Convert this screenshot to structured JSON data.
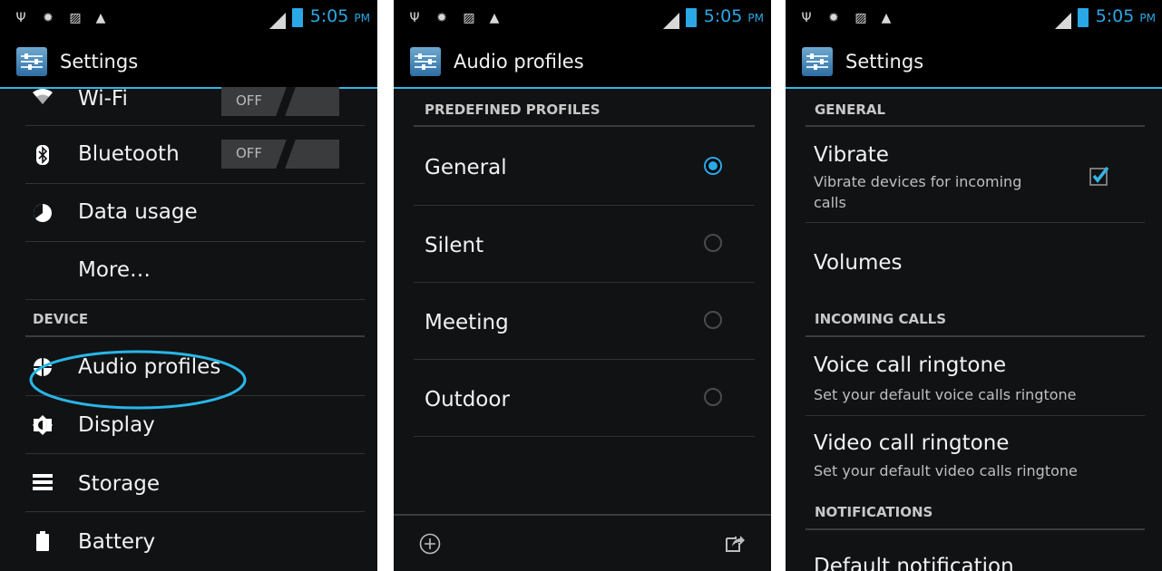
{
  "status_bar": {
    "time": "5:05",
    "ampm": "PM",
    "icons": [
      "usb-icon",
      "android-debug-icon",
      "image-notification-icon",
      "warning-icon",
      "signal-icon",
      "battery-charging-icon"
    ]
  },
  "screens": [
    {
      "title": "Settings",
      "items": [
        {
          "label": "Wi-Fi",
          "icon": "wifi-icon",
          "toggle": "OFF"
        },
        {
          "label": "Bluetooth",
          "icon": "bluetooth-icon",
          "toggle": "OFF"
        },
        {
          "label": "Data usage",
          "icon": "data-usage-icon"
        },
        {
          "label": "More…"
        }
      ],
      "section_device": "DEVICE",
      "device_items": [
        {
          "label": "Audio profiles",
          "icon": "audio-profiles-icon",
          "highlighted": true
        },
        {
          "label": "Display",
          "icon": "display-icon"
        },
        {
          "label": "Storage",
          "icon": "storage-icon"
        },
        {
          "label": "Battery",
          "icon": "battery-icon"
        }
      ],
      "highlight_color": "#29b6e8"
    },
    {
      "title": "Audio profiles",
      "section": "PREDEFINED PROFILES",
      "profiles": [
        {
          "label": "General",
          "selected": true
        },
        {
          "label": "Silent",
          "selected": false
        },
        {
          "label": "Meeting",
          "selected": false
        },
        {
          "label": "Outdoor",
          "selected": false
        }
      ],
      "bottom_actions": [
        "add-icon",
        "share-icon"
      ]
    },
    {
      "title": "Settings",
      "section_general": "GENERAL",
      "vibrate": {
        "title": "Vibrate",
        "subtitle_line1": "Vibrate devices for incoming",
        "subtitle_line2": "calls",
        "checked": true
      },
      "volumes": "Volumes",
      "section_incoming": "INCOMING CALLS",
      "voice_ringtone": {
        "title": "Voice call ringtone",
        "subtitle": "Set your default voice calls ringtone"
      },
      "video_ringtone": {
        "title": "Video call ringtone",
        "subtitle": "Set your default video calls ringtone"
      },
      "section_notifications": "NOTIFICATIONS",
      "default_notification": "Default notification"
    }
  ],
  "colors": {
    "accent": "#33b5e5",
    "background": "#111214",
    "status_bar": "#000000"
  }
}
